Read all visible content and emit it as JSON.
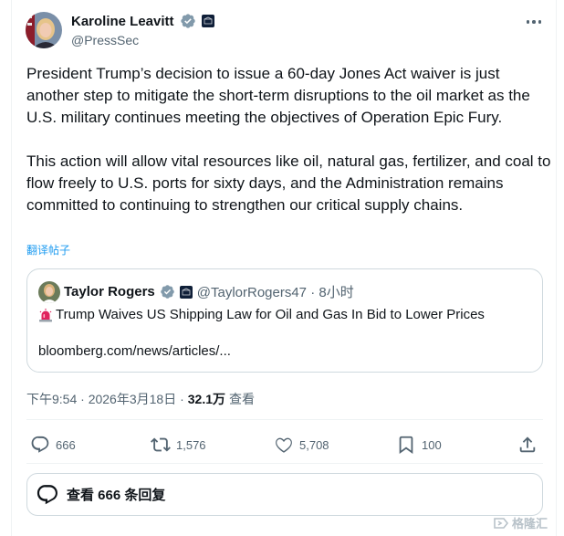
{
  "post": {
    "author_name": "Karoline Leavitt",
    "author_handle": "@PressSec",
    "paragraphs": [
      "President Trump’s decision to issue a 60-day Jones Act waiver is just another step to mitigate the short-term disruptions to the oil market as the U.S. military continues meeting the objectives of Operation Epic Fury.",
      "This action will allow vital resources like oil, natural gas, fertilizer, and coal to flow freely to U.S. ports for sixty days, and the Administration remains committed to continuing to strengthen our critical supply chains."
    ],
    "translate_label": "翻译帖子",
    "timestamp": "下午9:54 · 2026年3月18日 · ",
    "views_count": "32.1万",
    "views_label": "查看"
  },
  "quote": {
    "author_name": "Taylor Rogers",
    "handle_time": "@TaylorRogers47 · 8小时",
    "title": "Trump Waives US Shipping Law for Oil and Gas In Bid to Lower Prices",
    "link": "bloomberg.com/news/articles/..."
  },
  "actions": {
    "replies": "666",
    "reposts": "1,576",
    "likes": "5,708",
    "bookmarks": "100"
  },
  "reply_prompt": "查看 666 条回复",
  "watermark": "格隆汇",
  "colors": {
    "text": "#0f1419",
    "secondary": "#536471",
    "link": "#1d9bf0",
    "verified": "#829aab",
    "border": "#cfd9de"
  },
  "icons": [
    "verified-badge-icon",
    "government-affiliation-icon",
    "more-icon",
    "siren-icon",
    "reply-icon",
    "repost-icon",
    "like-icon",
    "bookmark-icon",
    "share-icon",
    "speech-bubble-icon"
  ]
}
